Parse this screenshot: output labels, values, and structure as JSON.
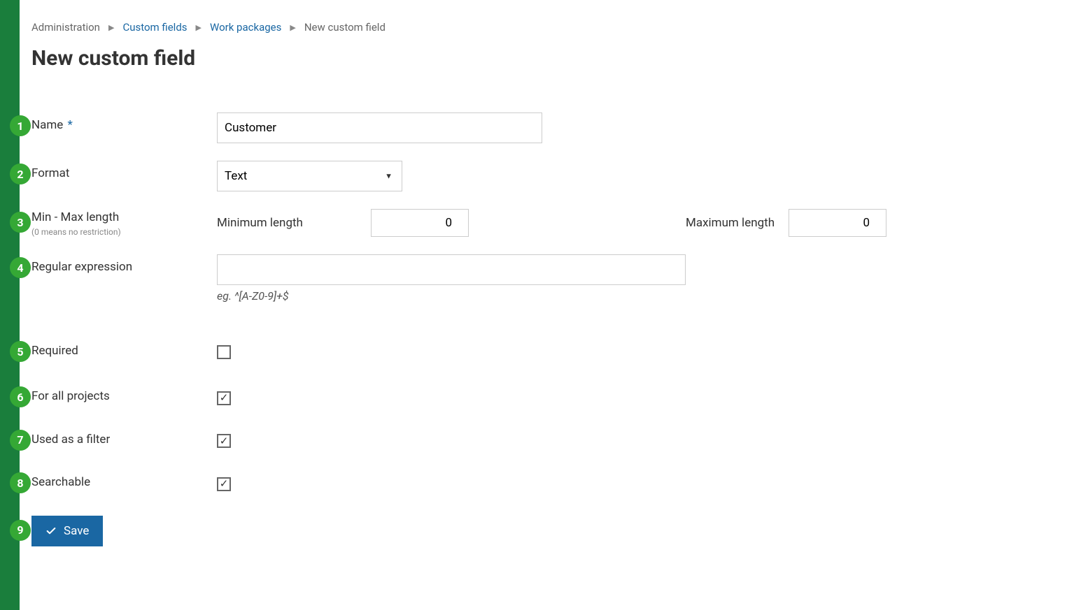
{
  "breadcrumb": {
    "administration": "Administration",
    "custom_fields": "Custom fields",
    "work_packages": "Work packages",
    "new_custom_field": "New custom field"
  },
  "page_title": "New custom field",
  "badges": {
    "b1": "1",
    "b2": "2",
    "b3": "3",
    "b4": "4",
    "b5": "5",
    "b6": "6",
    "b7": "7",
    "b8": "8",
    "b9": "9"
  },
  "form": {
    "name_label": "Name",
    "name_value": "Customer",
    "format_label": "Format",
    "format_value": "Text",
    "min_max_label": "Min - Max length",
    "min_max_hint": "(0 means no restriction)",
    "min_length_label": "Minimum length",
    "min_length_value": "0",
    "max_length_label": "Maximum length",
    "max_length_value": "0",
    "regex_label": "Regular expression",
    "regex_hint": "eg. ^[A-Z0-9]+$",
    "required_label": "Required",
    "for_all_label": "For all projects",
    "filter_label": "Used as a filter",
    "searchable_label": "Searchable",
    "save_label": "Save"
  },
  "checkboxes": {
    "required": false,
    "for_all_projects": true,
    "used_as_filter": true,
    "searchable": true
  }
}
